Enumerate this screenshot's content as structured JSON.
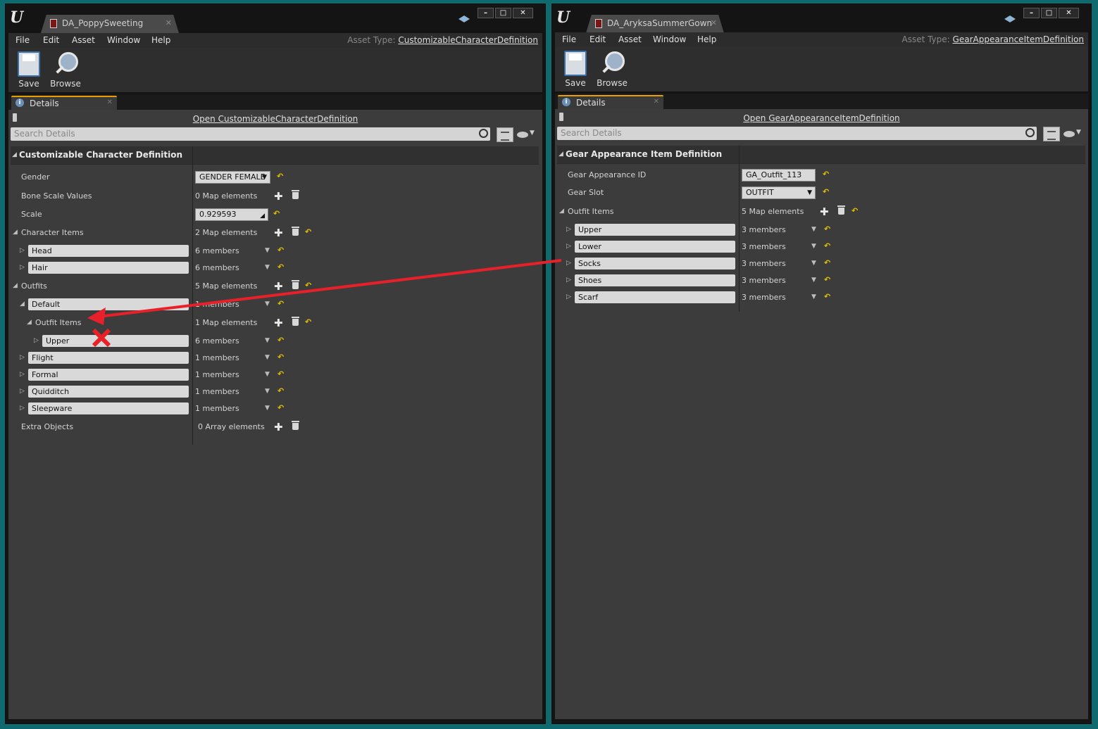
{
  "left": {
    "tab_title": "DA_PoppySweeting",
    "menu": [
      "File",
      "Edit",
      "Asset",
      "Window",
      "Help"
    ],
    "asset_type_label": "Asset Type:",
    "asset_type": "CustomizableCharacterDefinition",
    "toolbar": {
      "save": "Save",
      "browse": "Browse"
    },
    "panel_tab": "Details",
    "open_link": "Open CustomizableCharacterDefinition",
    "search_placeholder": "Search Details",
    "category": "Customizable Character Definition",
    "gender_label": "Gender",
    "gender_value": "GENDER FEMALE",
    "bone_label": "Bone Scale Values",
    "bone_value": "0 Map elements",
    "scale_label": "Scale",
    "scale_value": "0.929593",
    "char_items_label": "Character Items",
    "char_items_value": "2 Map elements",
    "head_key": "Head",
    "head_value": "6 members",
    "hair_key": "Hair",
    "hair_value": "6 members",
    "outfits_label": "Outfits",
    "outfits_value": "5 Map elements",
    "default_key": "Default",
    "default_value": "1 members",
    "outfit_items_label": "Outfit Items",
    "outfit_items_value": "1 Map elements",
    "upper_key": "Upper",
    "upper_value": "6 members",
    "flight_key": "Flight",
    "flight_value": "1 members",
    "formal_key": "Formal",
    "formal_value": "1 members",
    "quidditch_key": "Quidditch",
    "quidditch_value": "1 members",
    "sleepware_key": "Sleepware",
    "sleepware_value": "1 members",
    "extra_label": "Extra Objects",
    "extra_value": "0 Array elements"
  },
  "right": {
    "tab_title": "DA_AryksaSummerGown",
    "menu": [
      "File",
      "Edit",
      "Asset",
      "Window",
      "Help"
    ],
    "asset_type_label": "Asset Type:",
    "asset_type": "GearAppearanceItemDefinition",
    "toolbar": {
      "save": "Save",
      "browse": "Browse"
    },
    "panel_tab": "Details",
    "open_link": "Open GearAppearanceItemDefinition",
    "search_placeholder": "Search Details",
    "category": "Gear Appearance Item Definition",
    "gear_id_label": "Gear Appearance ID",
    "gear_id_value": "GA_Outfit_113",
    "gear_slot_label": "Gear Slot",
    "gear_slot_value": "OUTFIT",
    "outfit_items_label": "Outfit Items",
    "outfit_items_value": "5 Map elements",
    "items": [
      {
        "key": "Upper",
        "value": "3 members"
      },
      {
        "key": "Lower",
        "value": "3 members"
      },
      {
        "key": "Socks",
        "value": "3 members"
      },
      {
        "key": "Shoes",
        "value": "3 members"
      },
      {
        "key": "Scarf",
        "value": "3 members"
      }
    ]
  },
  "colors": {
    "background": "#0f6a70",
    "annotation": "#e8202a",
    "reset_arrow": "#e2c000"
  }
}
